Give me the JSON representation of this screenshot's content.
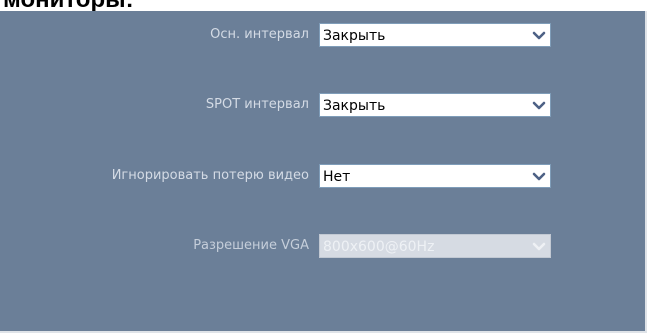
{
  "page": {
    "heading": "мониторы:"
  },
  "settings": [
    {
      "label": "Осн. интервал",
      "value": "Закрыть",
      "enabled": true
    },
    {
      "label": "SPOT интервал",
      "value": "Закрыть",
      "enabled": true
    },
    {
      "label": "Игнорировать потерю видео",
      "value": "Нет",
      "enabled": true
    },
    {
      "label": "Разрешение VGA",
      "value": "800x600@60Hz",
      "enabled": false
    }
  ],
  "icons": {
    "dropdown": "chevron-down-icon"
  },
  "colors": {
    "panel_background": "#6b7f98",
    "label_text": "#d4dbe5",
    "select_border": "#7f9db9",
    "disabled_select": "#d6dbe3"
  }
}
